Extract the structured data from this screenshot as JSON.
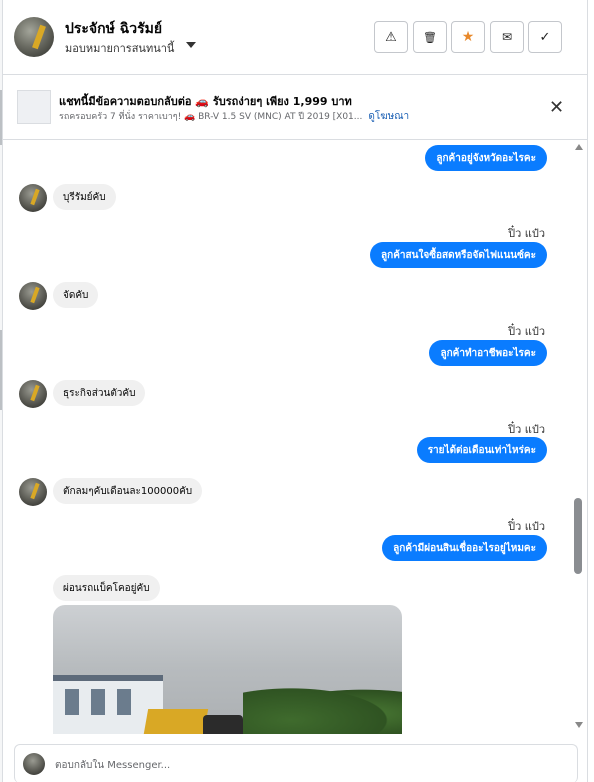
{
  "header": {
    "contact_name": "ประจักษ์ ฉิวรัมย์",
    "assign_label": "มอบหมายการสนทนานี้",
    "buttons": [
      {
        "icon": "warning-icon",
        "glyph": "⚠"
      },
      {
        "icon": "trash-icon",
        "glyph": "🗑"
      },
      {
        "icon": "star-icon",
        "glyph": "★"
      },
      {
        "icon": "mail-open-icon",
        "glyph": "✉"
      },
      {
        "icon": "check-icon",
        "glyph": "✓"
      }
    ]
  },
  "ad": {
    "title": "แชทนี้มีข้อความตอบกลับต่อ 🚗 รับรถง่ายๆ เพียง 1,999 บาท",
    "subtitle": "รถครอบครัว 7 ที่นั่ง ราคาเบาๆ! 🚗 BR-V 1.5 SV (MNC) AT ปี 2019 [X01...",
    "link": "ดูโฆษณา",
    "close": "✕"
  },
  "messages": [
    {
      "dir": "out",
      "text": "ลูกค้าอยู่จังหวัดอะไรคะ"
    },
    {
      "dir": "in",
      "text": "บุรีรัมย์คับ"
    },
    {
      "dir": "out",
      "sender": "ปิ๋ว แป๋ว",
      "text": "ลูกค้าสนใจซื้อสดหรือจัดไฟแนนซ์คะ"
    },
    {
      "dir": "in",
      "text": "จัดคับ"
    },
    {
      "dir": "out",
      "sender": "ปิ๋ว แป๋ว",
      "text": "ลูกค้าทำอาชีพอะไรคะ"
    },
    {
      "dir": "in",
      "text": "ธุระกิจส่วนตัวคับ"
    },
    {
      "dir": "out",
      "sender": "ปิ๋ว แป๋ว",
      "text": "รายได้ต่อเดือนเท่าไหร่คะ"
    },
    {
      "dir": "in",
      "text": "ตักลมๆคับเดือนละ100000คับ"
    },
    {
      "dir": "out",
      "sender": "ปิ๋ว แป๋ว",
      "text": "ลูกค้ามีผ่อนสินเชื่ออะไรอยู่ไหมคะ"
    },
    {
      "dir": "in",
      "text": "ผ่อนรถแบ็คโคอยู่คับ"
    }
  ],
  "composer": {
    "placeholder": "ตอบกลับใน Messenger..."
  },
  "colors": {
    "outgoing_bubble": "#0a7cff",
    "incoming_bubble": "#f0f0f0",
    "star": "#e8892b"
  }
}
